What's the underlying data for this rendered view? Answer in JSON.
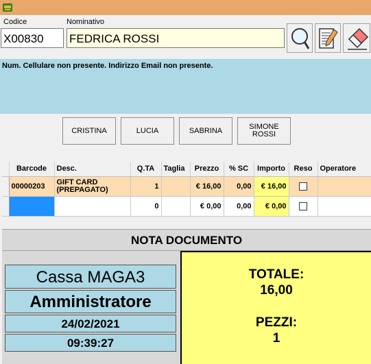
{
  "header": {
    "codice_label": "Codice",
    "nominativo_label": "Nominativo",
    "codice_value": "X00830",
    "nominativo_value": "FEDRICA ROSSI"
  },
  "toolbar": {
    "icons": [
      "search-icon",
      "edit-document-icon",
      "eraser-icon"
    ]
  },
  "message": "Num. Cellulare non presente. Indirizzo Email non presente.",
  "operators": [
    {
      "label": "CRISTINA"
    },
    {
      "label": "LUCIA"
    },
    {
      "label": "SABRINA"
    },
    {
      "label": "SIMONE ROSSI"
    }
  ],
  "grid": {
    "columns": [
      "Barcode",
      "Desc.",
      "Q.TA",
      "Taglia",
      "Prezzo",
      "% SC",
      "Importo",
      "Reso",
      "Operatore"
    ],
    "rows": [
      {
        "barcode": "00000203",
        "desc": "GIFT CARD (PREPAGATO)",
        "qta": "1",
        "taglia": "",
        "prezzo": "€ 16,00",
        "sc": "0,00",
        "importo": "€ 16,00",
        "reso": false,
        "operatore": ""
      },
      {
        "barcode": "",
        "desc": "",
        "qta": "0",
        "taglia": "",
        "prezzo": "€ 0,00",
        "sc": "0,00",
        "importo": "€ 0,00",
        "reso": false,
        "operatore": ""
      }
    ]
  },
  "nota": "NOTA DOCUMENTO",
  "info": {
    "cassa": "Cassa MAGA3",
    "utente": "Amministratore",
    "data": "24/02/2021",
    "ora": "09:39:27"
  },
  "totals": {
    "totale_label": "TOTALE:",
    "totale_value": "16,00",
    "pezzi_label": "PEZZI:",
    "pezzi_value": "1"
  },
  "colors": {
    "titlebar": "#e8a86a",
    "message_panel": "#add8e6",
    "row_highlight": "#fcdcb0",
    "totals_bg": "#ffff80",
    "selected_cell": "#1e90ff"
  }
}
